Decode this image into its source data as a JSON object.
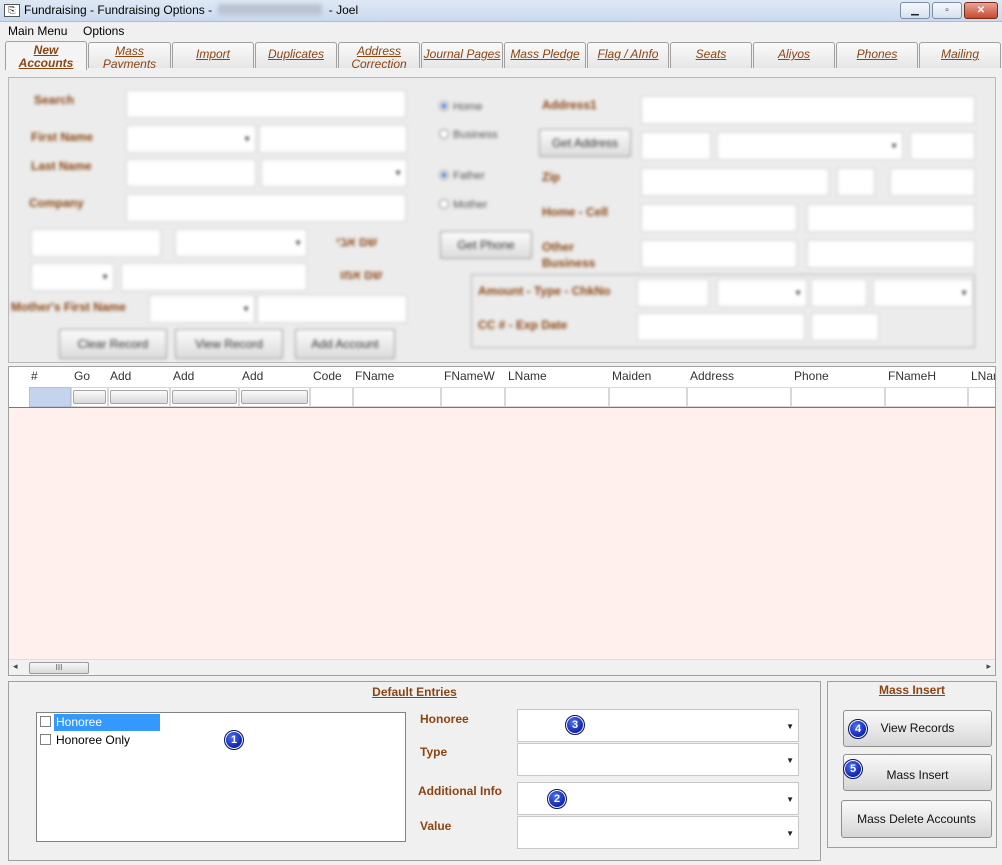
{
  "window": {
    "title": "Fundraising - Fundraising Options -",
    "title_user": "- Joel",
    "icon": "app-window-icon"
  },
  "window_controls": {
    "minimize": "▁",
    "maximize": "▫",
    "close": "✕"
  },
  "menu": {
    "main_menu": "Main Menu",
    "options": "Options"
  },
  "tabs": [
    {
      "line1": "New",
      "line2": "Accounts",
      "active": true
    },
    {
      "line1": "Mass",
      "line2": "Payments"
    },
    {
      "line1": "Import"
    },
    {
      "line1": "Duplicates"
    },
    {
      "line1": "Address",
      "line2": "Correction"
    },
    {
      "line1": "Journal Pages"
    },
    {
      "line1": "Mass Pledge"
    },
    {
      "line1": "Flag / AInfo"
    },
    {
      "line1": "Seats"
    },
    {
      "line1": "Aliyos"
    },
    {
      "line1": "Phones"
    },
    {
      "line1": "Mailing"
    }
  ],
  "form": {
    "search_label": "Search",
    "first_name_label": "First Name",
    "last_name_label": "Last Name",
    "company_label": "Company",
    "hebrew_label_1": "שם אבי",
    "hebrew_label_2": "שם אמו",
    "mothers_first_name_label": "Mother's First Name",
    "radio_home": "Home",
    "radio_business": "Business",
    "radio_father": "Father",
    "radio_mother": "Mother",
    "address_label": "Address1",
    "get_address_button": "Get Address",
    "zip_label": "Zip",
    "home_cell_label": "Home - Cell",
    "get_phone_button": "Get Phone",
    "other_business_label_1": "Other",
    "other_business_label_2": "Business",
    "amount_type_label": "Amount - Type - ChkNo",
    "cc_exp_label": "CC # - Exp Date",
    "clear_record_button": "Clear Record",
    "view_record_button": "View Record",
    "add_account_button": "Add Account"
  },
  "grid": {
    "columns": [
      "#",
      "Go",
      "Add",
      "Add",
      "Add",
      "Code",
      "FName",
      "FNameW",
      "LName",
      "Maiden",
      "Address",
      "Phone",
      "FNameH",
      "LNar"
    ],
    "scroll_thumb": "III",
    "scroll_left": "◂",
    "scroll_right": "▸"
  },
  "default_entries": {
    "title": "Default Entries",
    "list_items": [
      "Honoree",
      "Honoree Only"
    ],
    "honoree_label": "Honoree",
    "type_label": "Type",
    "additional_info_label": "Additional Info",
    "value_label": "Value",
    "caret": "▼"
  },
  "mass_insert": {
    "title": "Mass Insert",
    "view_records_button": "View Records",
    "mass_insert_button": "Mass Insert",
    "mass_delete_button": "Mass Delete Accounts"
  },
  "markers": [
    "1",
    "2",
    "3",
    "4",
    "5"
  ],
  "colors": {
    "label_brown": "#8b4513",
    "grid_body": "#fff0ee",
    "selection": "#3399ff",
    "marker_blue": "#0a1fa8"
  }
}
